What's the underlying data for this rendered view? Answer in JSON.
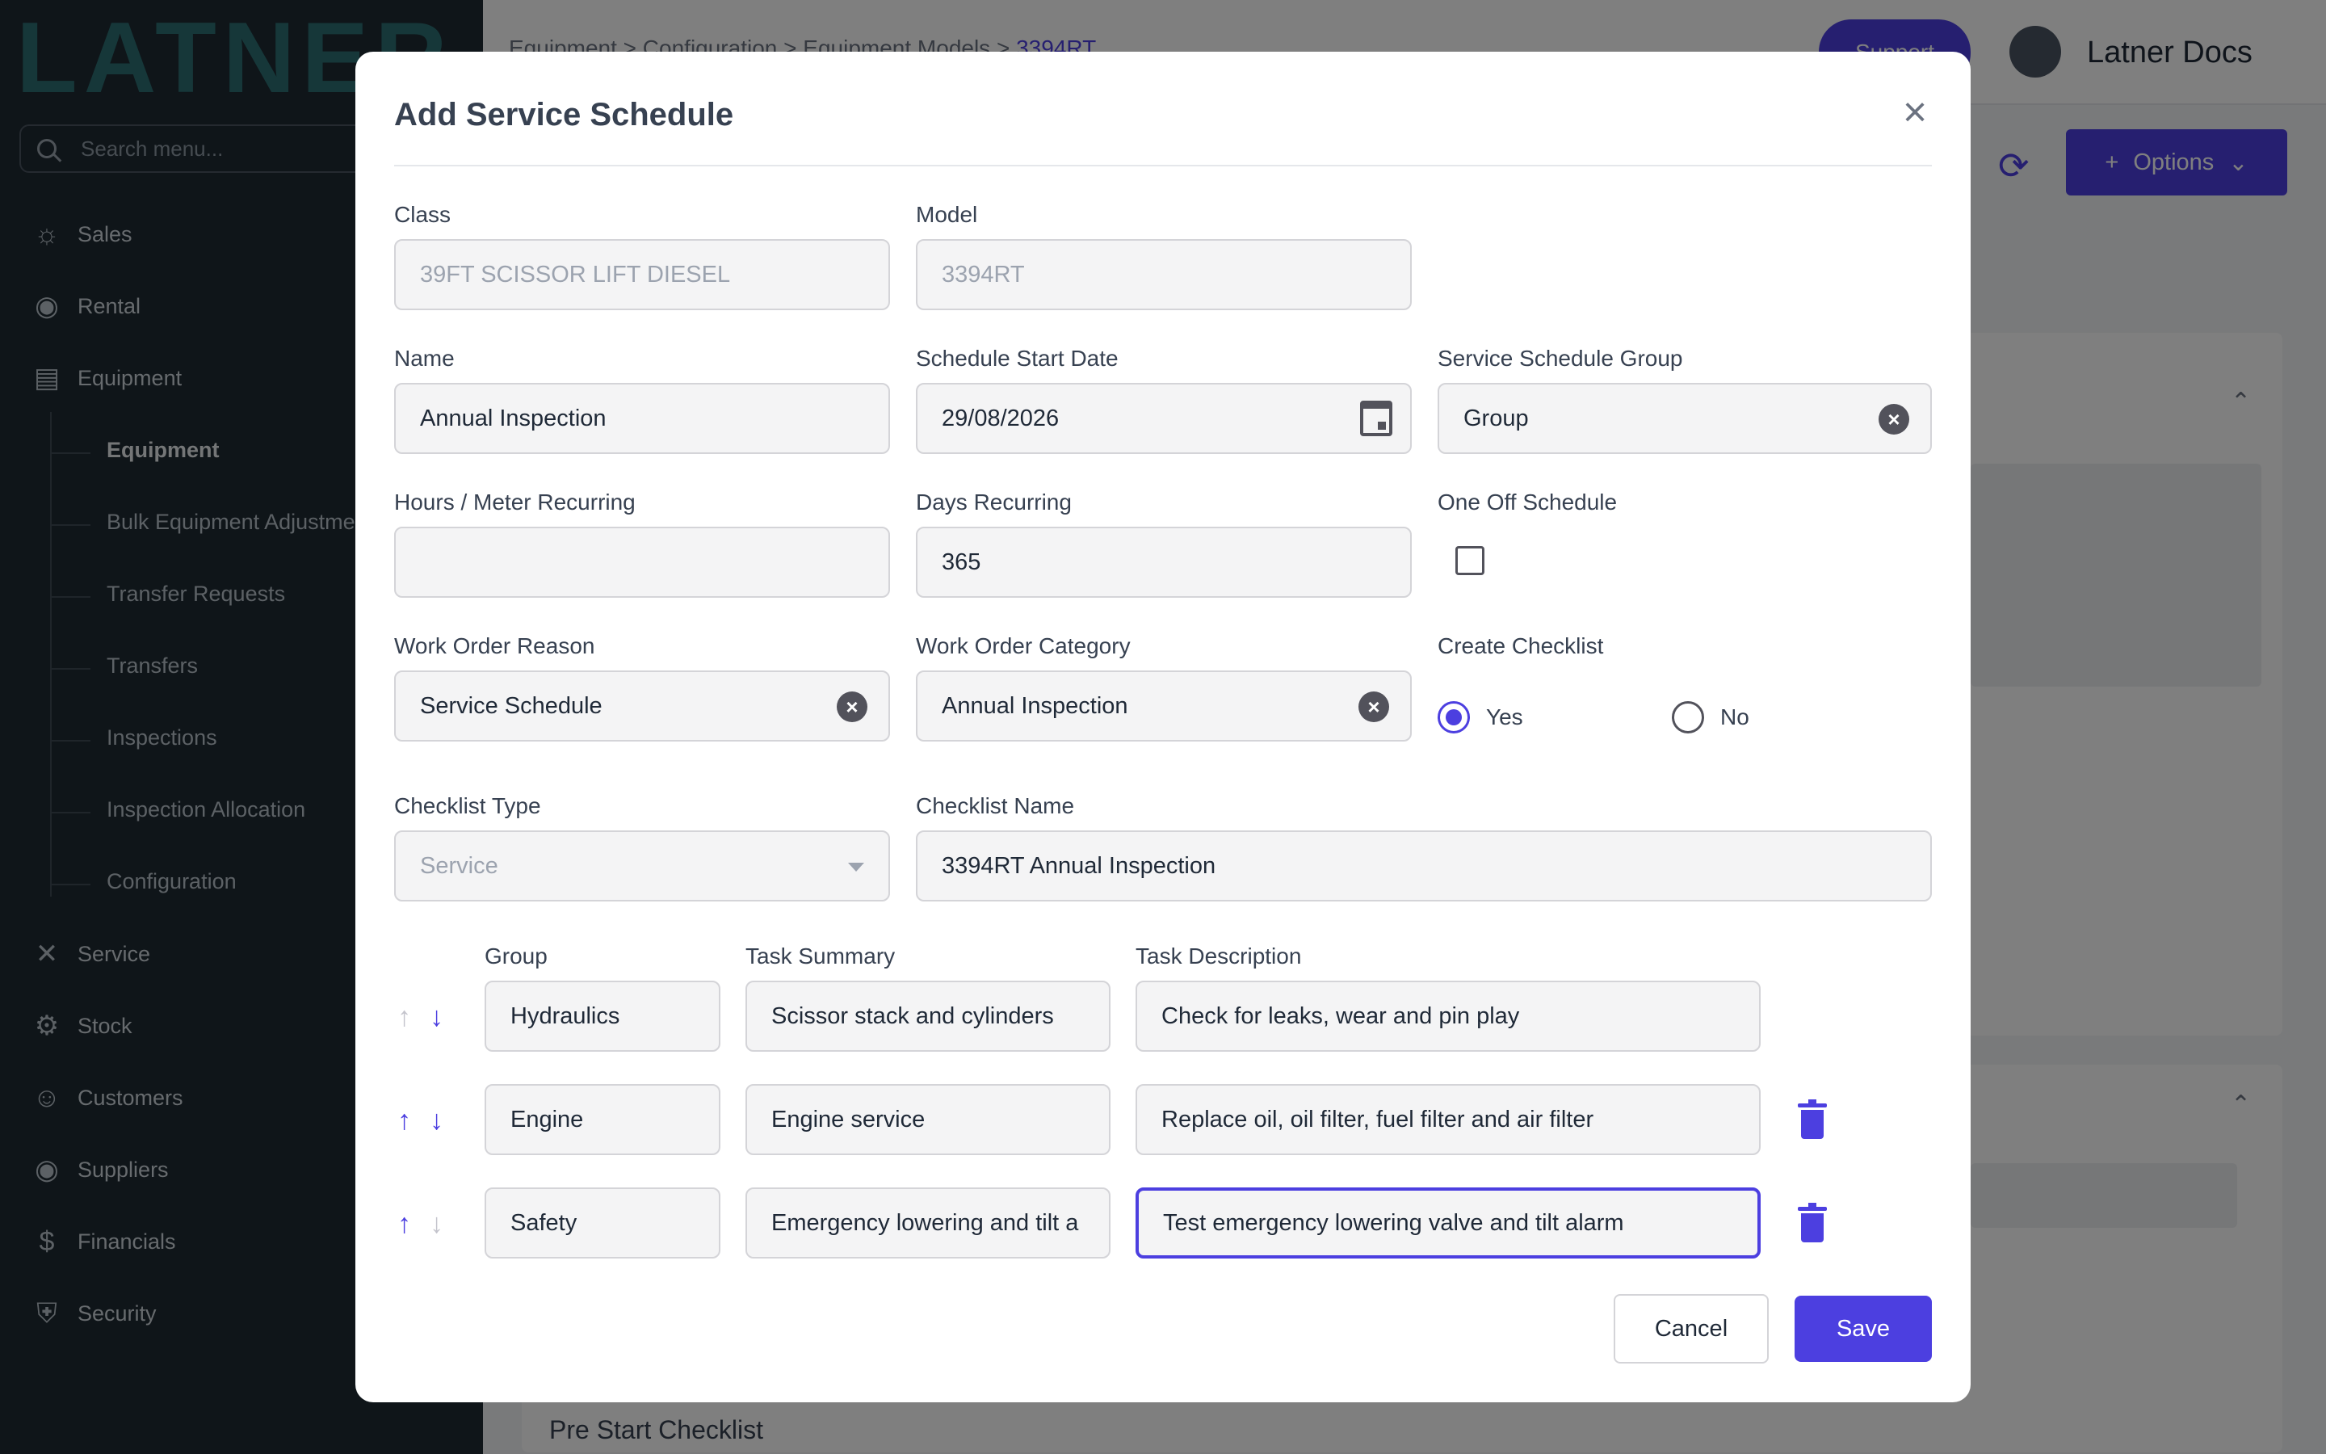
{
  "app": {
    "logo": "LATNER",
    "user_name": "Latner Docs",
    "support_label": "Support",
    "options_label": "Options"
  },
  "sidebar": {
    "search_placeholder": "Search menu...",
    "items": [
      {
        "label": "Sales",
        "icon": "sales-icon"
      },
      {
        "label": "Rental",
        "icon": "rental-icon"
      },
      {
        "label": "Equipment",
        "icon": "equipment-icon"
      },
      {
        "label": "Service",
        "icon": "service-icon"
      },
      {
        "label": "Stock",
        "icon": "stock-icon"
      },
      {
        "label": "Customers",
        "icon": "customers-icon"
      },
      {
        "label": "Suppliers",
        "icon": "suppliers-icon"
      },
      {
        "label": "Financials",
        "icon": "financials-icon"
      },
      {
        "label": "Security",
        "icon": "security-icon"
      }
    ],
    "equipment_sub": [
      "Equipment",
      "Bulk Equipment Adjustments",
      "Transfer Requests",
      "Transfers",
      "Inspections",
      "Inspection Allocation",
      "Configuration"
    ]
  },
  "breadcrumb": [
    "Equipment",
    "Configuration",
    "Equipment Models",
    "3394RT"
  ],
  "background": {
    "pre_start": "Pre Start Checklist"
  },
  "modal": {
    "title": "Add Service Schedule",
    "class_label": "Class",
    "class_value": "39FT SCISSOR LIFT DIESEL",
    "model_label": "Model",
    "model_value": "3394RT",
    "name_label": "Name",
    "name_value": "Annual Inspection",
    "start_date_label": "Schedule Start Date",
    "start_date_value": "29/08/2026",
    "group_label": "Service Schedule Group",
    "group_value": "Group",
    "hours_label": "Hours / Meter Recurring",
    "hours_value": "",
    "days_label": "Days Recurring",
    "days_value": "365",
    "one_off_label": "One Off Schedule",
    "wo_reason_label": "Work Order Reason",
    "wo_reason_value": "Service Schedule",
    "wo_category_label": "Work Order Category",
    "wo_category_value": "Annual Inspection",
    "create_checklist_label": "Create Checklist",
    "yes_label": "Yes",
    "no_label": "No",
    "checklist_type_label": "Checklist Type",
    "checklist_type_value": "Service",
    "checklist_name_label": "Checklist Name",
    "checklist_name_value": "3394RT Annual Inspection",
    "col_group": "Group",
    "col_summary": "Task Summary",
    "col_description": "Task Description",
    "tasks": [
      {
        "group": "Hydraulics",
        "summary": "Scissor stack and cylinders",
        "description": "Check for leaks, wear and pin play"
      },
      {
        "group": "Engine",
        "summary": "Engine service",
        "description": "Replace oil, oil filter, fuel filter and air filter"
      },
      {
        "group": "Safety",
        "summary": "Emergency lowering and tilt a",
        "description": "Test emergency lowering valve and tilt alarm"
      }
    ],
    "cancel_label": "Cancel",
    "save_label": "Save"
  },
  "colors": {
    "accent": "#4c3fe0",
    "sidebar_bg": "#1e2a33"
  }
}
